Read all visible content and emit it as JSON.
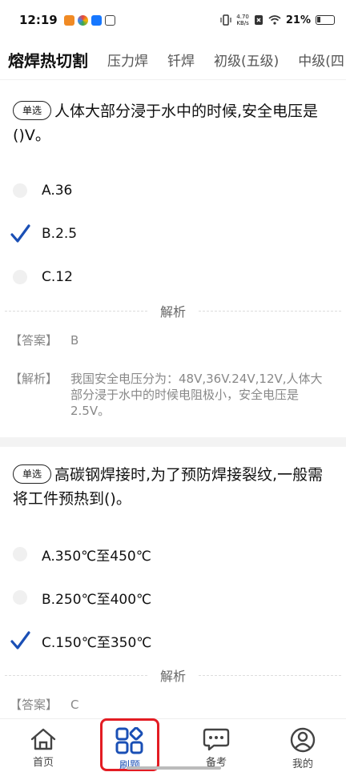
{
  "status_bar": {
    "time": "12:19",
    "net_speed_value": "4.70",
    "net_speed_unit": "KB/s",
    "battery": "21%"
  },
  "tabs": [
    {
      "label": "熔焊热切割",
      "active": true
    },
    {
      "label": "压力焊"
    },
    {
      "label": "钎焊"
    },
    {
      "label": "初级(五级)"
    },
    {
      "label": "中级(四"
    }
  ],
  "questions": [
    {
      "type_badge": "单选",
      "text": "人体大部分浸于水中的时候,安全电压是()V。",
      "options": [
        {
          "label": "A.36",
          "selected": false
        },
        {
          "label": "B.2.5",
          "selected": true
        },
        {
          "label": "C.12",
          "selected": false
        }
      ],
      "analysis_title": "解析",
      "answer_key": "【答案】",
      "answer": "B",
      "explanation_key": "【解析】",
      "explanation": "我国安全电压分为：48V,36V.24V,12V,人体大部分浸于水中的时候电阻极小，安全电压是2.5V。"
    },
    {
      "type_badge": "单选",
      "text": "高碳钢焊接时,为了预防焊接裂纹,一般需将工件预热到()。",
      "options": [
        {
          "label": "A.350℃至450℃",
          "selected": false
        },
        {
          "label": "B.250℃至400℃",
          "selected": false
        },
        {
          "label": "C.150℃至350℃",
          "selected": true
        }
      ],
      "analysis_title": "解析",
      "answer_key": "【答案】",
      "answer": "C"
    }
  ],
  "bottom_nav": [
    {
      "label": "首页",
      "icon": "home-icon"
    },
    {
      "label": "刷题",
      "icon": "grid-icon",
      "active": true
    },
    {
      "label": "备考",
      "icon": "chat-icon"
    },
    {
      "label": "我的",
      "icon": "user-icon"
    }
  ],
  "colors": {
    "accent": "#1a4fb5",
    "highlight": "#e31c23",
    "check": "#1a4fb5"
  }
}
